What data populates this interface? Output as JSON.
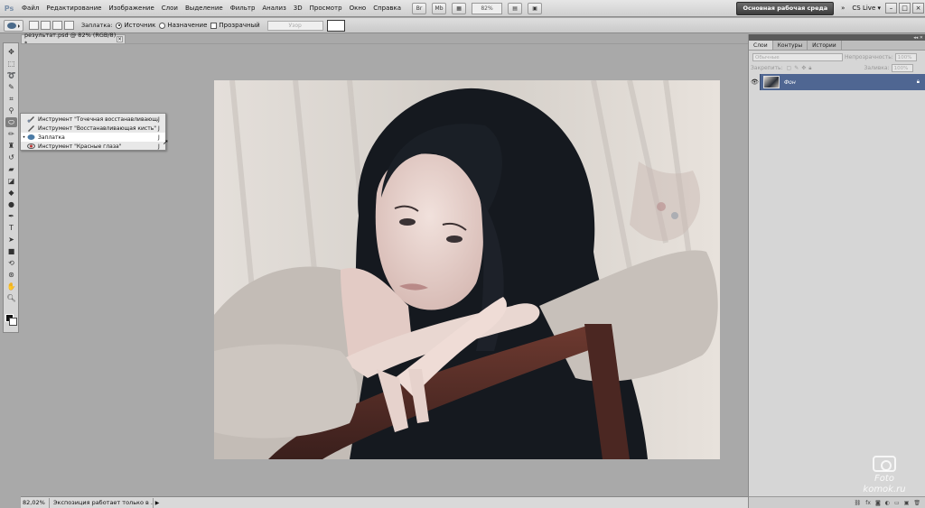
{
  "app": {
    "logo": "Ps"
  },
  "menu": [
    "Файл",
    "Редактирование",
    "Изображение",
    "Слои",
    "Выделение",
    "Фильтр",
    "Анализ",
    "3D",
    "Просмотр",
    "Окно",
    "Справка"
  ],
  "menubar": {
    "zoom": "82%",
    "workspace": "Основная рабочая среда",
    "more": "»",
    "cslive": "CS Live ▾",
    "win_min": "–",
    "win_max": "□",
    "win_close": "×",
    "btn_br": "Br",
    "btn_mb": "Mb"
  },
  "options": {
    "label_patch": "Заплатка:",
    "radio_source": "Источник",
    "radio_dest": "Назначение",
    "check_transparent": "Прозрачный",
    "pattern_btn": "Узор"
  },
  "document": {
    "tab_title": "результат.psd @ 82% (RGB/8) *",
    "close": "×"
  },
  "flyout": [
    {
      "label": "Инструмент \"Точечная восстанавливающая кисть\"",
      "key": "J",
      "selected": false
    },
    {
      "label": "Инструмент \"Восстанавливающая кисть\"",
      "key": "J",
      "selected": false
    },
    {
      "label": "Заплатка",
      "key": "J",
      "selected": true,
      "bullet": "•"
    },
    {
      "label": "Инструмент \"Красные глаза\"",
      "key": "J",
      "selected": false
    }
  ],
  "status": {
    "zoom": "82,02%",
    "info": "Экспозиция работает только в ...",
    "arrow": "▶"
  },
  "panels": {
    "tabs": [
      "Слои",
      "Контуры",
      "Истории"
    ],
    "blend_mode": "Обычные",
    "opacity_label": "Непрозрачность:",
    "opacity_value": "100%",
    "lock_label": "Закрепить:",
    "fill_label": "Заливка:",
    "fill_value": "100%",
    "layer_name": "Фон",
    "collapse": "◂◂ ✕"
  },
  "watermark": {
    "line1": "Foto",
    "line2": "komok.ru"
  },
  "colors": {
    "layer_selected": "#4f6692",
    "canvas_bg": "#a9a9a9"
  }
}
